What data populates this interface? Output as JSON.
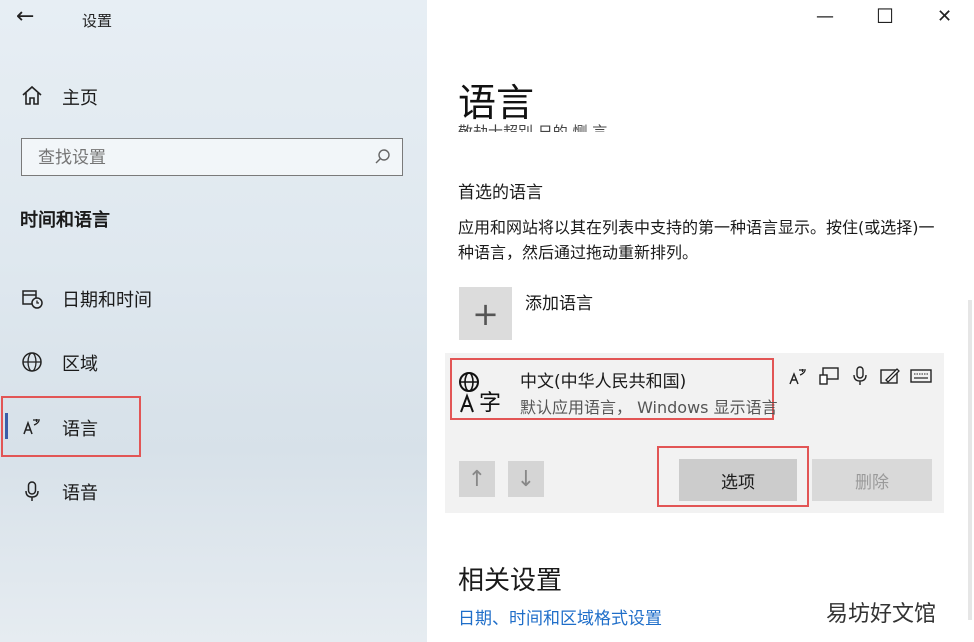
{
  "window": {
    "back_glyph": "←",
    "title": "设置",
    "minimize_glyph": "—",
    "maximize_glyph": "☐",
    "close_glyph": "✕"
  },
  "sidebar": {
    "home_label": "主页",
    "search_placeholder": "查找设置",
    "section_title": "时间和语言",
    "items": [
      {
        "label": "日期和时间",
        "icon": "calendar-clock-icon"
      },
      {
        "label": "区域",
        "icon": "globe-icon"
      },
      {
        "label": "语言",
        "icon": "language-icon",
        "selected": true
      },
      {
        "label": "语音",
        "icon": "microphone-icon"
      }
    ]
  },
  "main": {
    "title": "语言",
    "partial_text": "敬劫士超别 日的 恻 言。",
    "preferred_heading": "首选的语言",
    "preferred_desc": "应用和网站将以其在列表中支持的第一种语言显示。按住(或选择)一种语言，然后通过拖动重新排列。",
    "add_language_label": "添加语言",
    "add_glyph": "+",
    "language": {
      "name": "中文(中华人民共和国)",
      "subtitle": "默认应用语言， Windows 显示语言",
      "feature_icons": [
        "language-pack-icon",
        "display-icon",
        "speech-icon",
        "handwriting-icon",
        "keyboard-icon"
      ]
    },
    "move_up_glyph": "↑",
    "move_down_glyph": "↓",
    "options_label": "选项",
    "remove_label": "删除",
    "related_heading": "相关设置",
    "related_link": "日期、时间和区域格式设置"
  },
  "watermark": "易坊好文馆",
  "colors": {
    "highlight_border": "#e25555",
    "link": "#1f6ec9",
    "selection_bar": "#3b5ea8"
  }
}
